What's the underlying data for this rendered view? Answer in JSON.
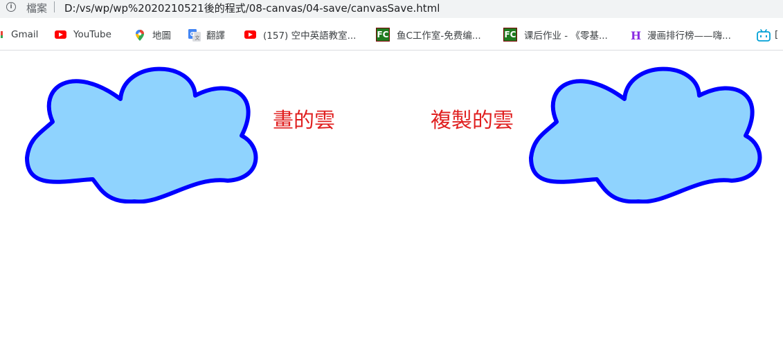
{
  "addressbar": {
    "scheme_label": "檔案",
    "url": "D:/vs/wp/wp%2020210521後的程式/08-canvas/04-save/canvasSave.html"
  },
  "bookmarks": [
    {
      "label": "Gmail",
      "icon": "gmail-icon"
    },
    {
      "label": "YouTube",
      "icon": "youtube-icon"
    },
    {
      "label": "地圖",
      "icon": "maps-icon"
    },
    {
      "label": "翻譯",
      "icon": "translate-icon"
    },
    {
      "label": "(157) 空中英語教室...",
      "icon": "youtube-icon"
    },
    {
      "label": "鱼C工作室-免费编...",
      "icon": "fc-icon"
    },
    {
      "label": "课后作业 - 《零基...",
      "icon": "fc-icon"
    },
    {
      "label": "漫画排行榜——嗨...",
      "icon": "h-logo-icon"
    },
    {
      "label": "[",
      "icon": "bilibili-icon"
    }
  ],
  "page": {
    "caption_drawn": "畫的雲",
    "caption_copied": "複製的雲"
  },
  "colors": {
    "cloud_fill": "#8fd3fe",
    "cloud_stroke": "#0000ff",
    "caption": "#e02020"
  }
}
